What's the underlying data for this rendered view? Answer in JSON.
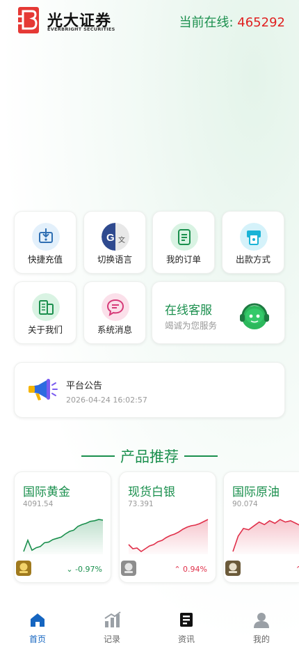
{
  "header": {
    "brand_cn": "光大证券",
    "brand_en": "EVERBRIGHT SECURITIES",
    "online_label": "当前在线: ",
    "online_count": "465292"
  },
  "shortcuts": [
    {
      "label": "快捷充值",
      "icon": "deposit-icon"
    },
    {
      "label": "切换语言",
      "icon": "translate-icon"
    },
    {
      "label": "我的订单",
      "icon": "order-icon"
    },
    {
      "label": "出款方式",
      "icon": "withdraw-icon"
    },
    {
      "label": "关于我们",
      "icon": "about-icon"
    },
    {
      "label": "系统消息",
      "icon": "message-icon"
    }
  ],
  "service": {
    "title": "在线客服",
    "subtitle": "竭诚为您服务"
  },
  "notice": {
    "title": "平台公告",
    "time": "2026-04-24 16:02:57"
  },
  "section_title": "产品推荐",
  "products": [
    {
      "name": "国际黄金",
      "price": "4091.54",
      "change": "-0.97%",
      "direction": "down",
      "series": [
        12,
        30,
        14,
        18,
        20,
        26,
        27,
        31,
        33,
        35,
        40,
        44,
        46,
        52,
        55,
        57,
        60,
        61,
        63,
        62
      ]
    },
    {
      "name": "现货白银",
      "price": "73.391",
      "change": "0.94%",
      "direction": "up",
      "series": [
        20,
        14,
        15,
        10,
        14,
        18,
        20,
        24,
        26,
        30,
        33,
        35,
        38,
        42,
        45,
        47,
        48,
        50,
        53,
        56
      ]
    },
    {
      "name": "国际原油",
      "price": "90.074",
      "change": "",
      "direction": "up",
      "series": [
        22,
        34,
        40,
        39,
        42,
        45,
        43,
        46,
        44,
        47,
        45,
        46,
        44,
        42
      ]
    }
  ],
  "tabs": [
    {
      "label": "首页",
      "icon": "home-icon",
      "active": true
    },
    {
      "label": "记录",
      "icon": "chart-icon",
      "active": false
    },
    {
      "label": "资讯",
      "icon": "news-icon",
      "active": false
    },
    {
      "label": "我的",
      "icon": "user-icon",
      "active": false
    }
  ],
  "colors": {
    "brand_green": "#1a8f4d",
    "up_red": "#e0304a",
    "accent_blue": "#1565c0"
  }
}
